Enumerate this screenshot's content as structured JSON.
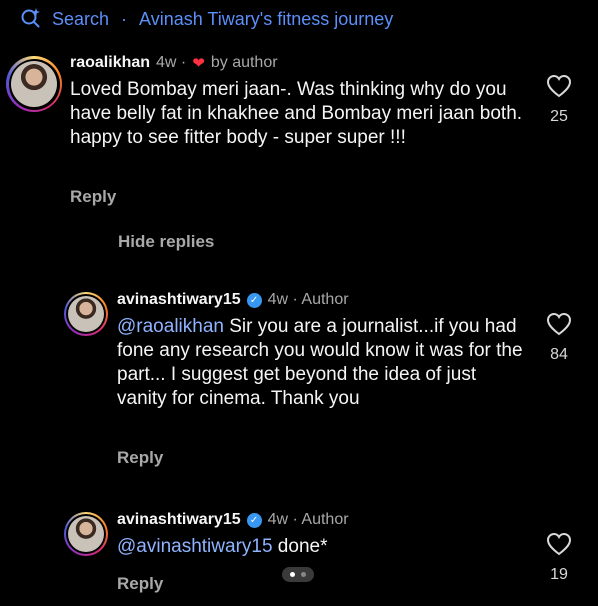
{
  "search": {
    "prefix": "Search",
    "separator": "·",
    "query": "Avinash Tiwary's fitness journey"
  },
  "comments": [
    {
      "username": "raoalikhan",
      "time": "4w ·",
      "liked_by": "by author",
      "text": "Loved Bombay meri jaan-. Was thinking why do you  have belly fat in khakhee and Bombay meri jaan both.  happy to see fitter body - super super !!!",
      "reply_label": "Reply",
      "likes": "25"
    }
  ],
  "hide_replies": "Hide replies",
  "replies": [
    {
      "username": "avinashtiwary15",
      "time": "4w · Author",
      "mention": "@raoalikhan",
      "text": " Sir you are a journalist...if you had fone any research you would know it was for the part... I suggest get beyond the idea of just vanity for cinema. Thank you",
      "reply_label": "Reply",
      "likes": "84"
    },
    {
      "username": "avinashtiwary15",
      "time": "4w · Author",
      "mention": "@avinashtiwary15",
      "text": " done*",
      "reply_label": "Reply",
      "likes": "19"
    }
  ],
  "colors": {
    "accent": "#5b8ff9",
    "heart": "#ff3040",
    "verified": "#3897f0"
  }
}
